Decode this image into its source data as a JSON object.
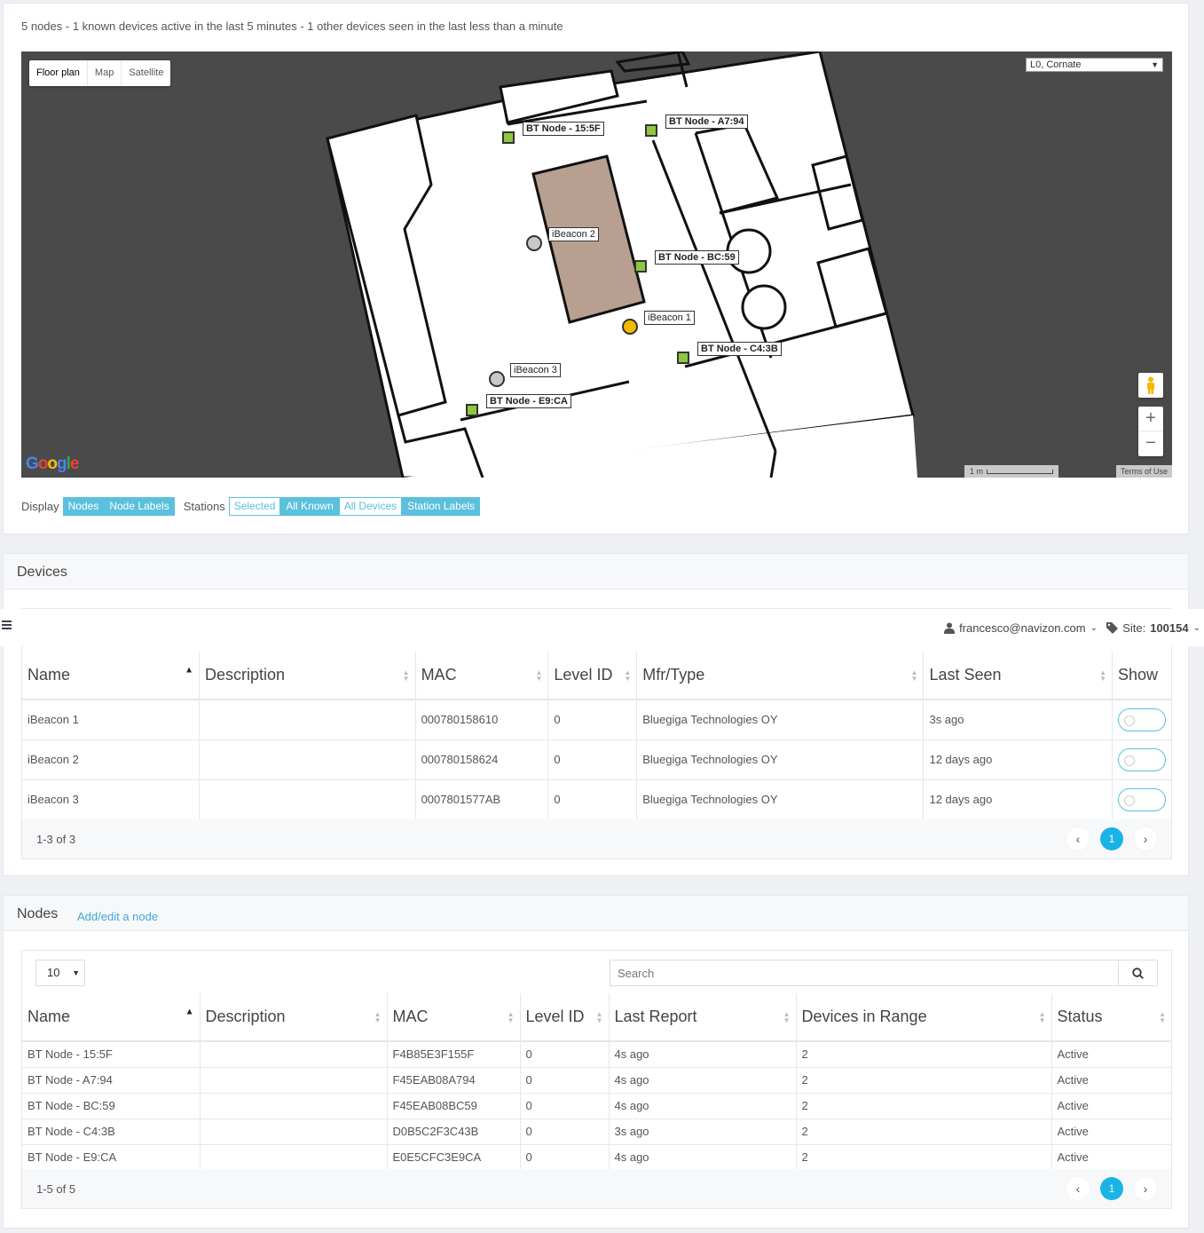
{
  "summary": "5 nodes -  1 known devices active in the last 5 minutes - 1 other devices seen in the last less than a minute",
  "map": {
    "types": [
      "Floor plan",
      "Map",
      "Satellite"
    ],
    "level_select": "L0, Cornate",
    "scale": "1 m",
    "terms": "Terms of Use",
    "logo": "Google",
    "nodes": [
      {
        "label": "BT Node - 15:5F"
      },
      {
        "label": "BT Node - A7:94"
      },
      {
        "label": "BT Node - BC:59"
      },
      {
        "label": "BT Node - C4:3B"
      },
      {
        "label": "BT Node - E9:CA"
      }
    ],
    "beacons": [
      {
        "label": "iBeacon 1",
        "color": "#f5b800"
      },
      {
        "label": "iBeacon 2",
        "color": "#c8c8c8"
      },
      {
        "label": "iBeacon 3",
        "color": "#c8c8c8"
      }
    ],
    "room_color": "#b8a090",
    "node_color": "#8dc63f"
  },
  "display": {
    "label": "Display",
    "buttons": [
      {
        "label": "Nodes",
        "on": true
      },
      {
        "label": "Node Labels",
        "on": true
      }
    ]
  },
  "stations": {
    "label": "Stations",
    "buttons": [
      {
        "label": "Selected",
        "on": false
      },
      {
        "label": "All Known",
        "on": true
      },
      {
        "label": "All Devices",
        "on": false
      },
      {
        "label": "Station Labels",
        "on": true
      }
    ]
  },
  "topbar": {
    "user": "francesco@navizon.com",
    "site_label": "Site:",
    "site_value": "100154"
  },
  "devices": {
    "title": "Devices",
    "columns": [
      "Name",
      "Description",
      "MAC",
      "Level ID",
      "Mfr/Type",
      "Last Seen",
      "Show"
    ],
    "rows": [
      {
        "name": "iBeacon 1",
        "description": "",
        "mac": "000780158610",
        "level": "0",
        "mfr": "Bluegiga Technologies OY",
        "last_seen": "3s ago"
      },
      {
        "name": "iBeacon 2",
        "description": "",
        "mac": "000780158624",
        "level": "0",
        "mfr": "Bluegiga Technologies OY",
        "last_seen": "12 days ago"
      },
      {
        "name": "iBeacon 3",
        "description": "",
        "mac": "0007801577AB",
        "level": "0",
        "mfr": "Bluegiga Technologies OY",
        "last_seen": "12 days ago"
      }
    ],
    "range": "1-3",
    "of": "of 3",
    "page": "1"
  },
  "nodes": {
    "title": "Nodes",
    "add_link": "Add/edit a node",
    "per_page": "10",
    "search_placeholder": "Search",
    "columns": [
      "Name",
      "Description",
      "MAC",
      "Level ID",
      "Last Report",
      "Devices in Range",
      "Status"
    ],
    "rows": [
      {
        "name": "BT Node - 15:5F",
        "description": "",
        "mac": "F4B85E3F155F",
        "level": "0",
        "last_report": "4s ago",
        "in_range": "2",
        "status": "Active"
      },
      {
        "name": "BT Node - A7:94",
        "description": "",
        "mac": "F45EAB08A794",
        "level": "0",
        "last_report": "4s ago",
        "in_range": "2",
        "status": "Active"
      },
      {
        "name": "BT Node - BC:59",
        "description": "",
        "mac": "F45EAB08BC59",
        "level": "0",
        "last_report": "4s ago",
        "in_range": "2",
        "status": "Active"
      },
      {
        "name": "BT Node - C4:3B",
        "description": "",
        "mac": "D0B5C2F3C43B",
        "level": "0",
        "last_report": "3s ago",
        "in_range": "2",
        "status": "Active"
      },
      {
        "name": "BT Node - E9:CA",
        "description": "",
        "mac": "E0E5CFC3E9CA",
        "level": "0",
        "last_report": "4s ago",
        "in_range": "2",
        "status": "Active"
      }
    ],
    "range": "1-5",
    "of": "of 5",
    "page": "1"
  }
}
